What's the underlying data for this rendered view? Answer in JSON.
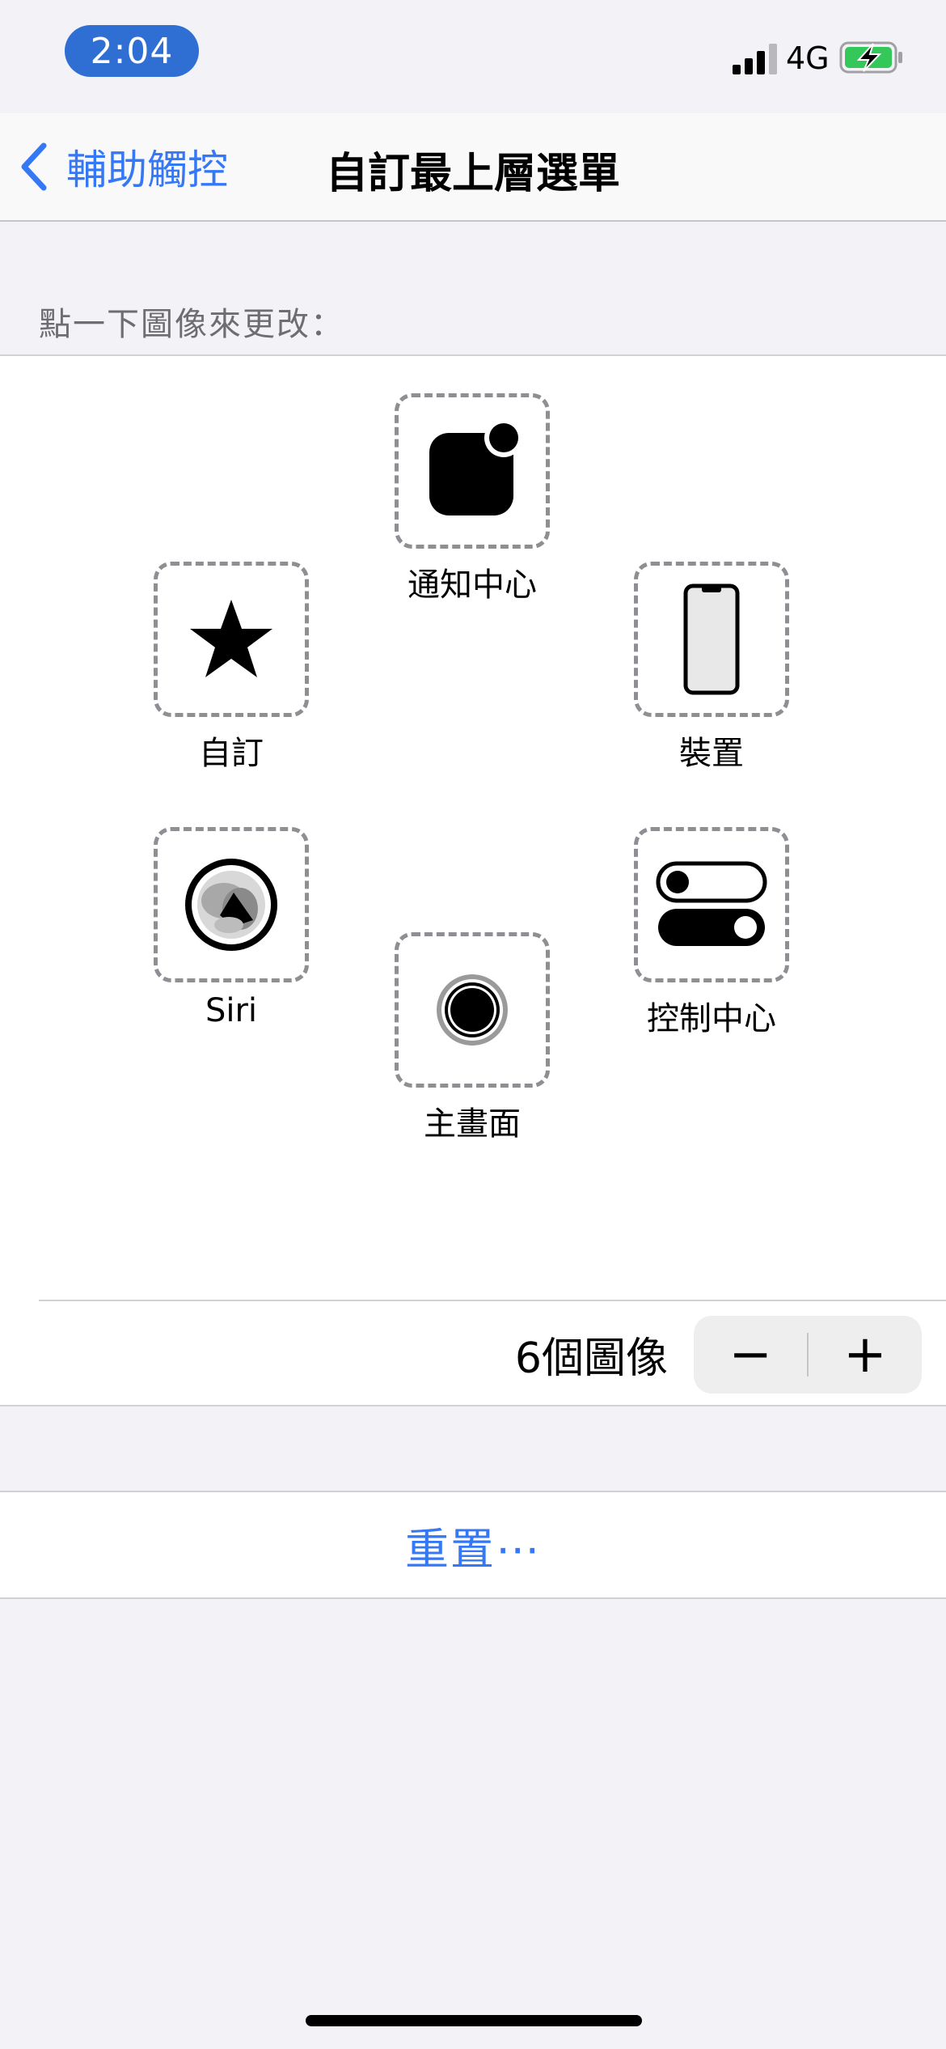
{
  "status_bar": {
    "time": "2:04",
    "network": "4G",
    "signal_icon": "signal-bars-icon",
    "battery_icon": "battery-charging-icon",
    "battery_color": "#34c759"
  },
  "nav": {
    "back_label": "輔助觸控",
    "title": "自訂最上層選單"
  },
  "section_header": "點一下圖像來更改：",
  "menu_items": [
    {
      "label": "通知中心",
      "icon": "notification-center-icon"
    },
    {
      "label": "自訂",
      "icon": "star-icon"
    },
    {
      "label": "裝置",
      "icon": "device-iphone-icon"
    },
    {
      "label": "Siri",
      "icon": "siri-icon"
    },
    {
      "label": "控制中心",
      "icon": "control-center-toggles-icon"
    },
    {
      "label": "主畫面",
      "icon": "home-button-icon"
    }
  ],
  "counter": {
    "label": "6個圖像",
    "decrement": "−",
    "increment": "+"
  },
  "reset_label": "重置⋯",
  "colors": {
    "accent": "#3478f6",
    "time_pill": "#2f6fd4"
  }
}
